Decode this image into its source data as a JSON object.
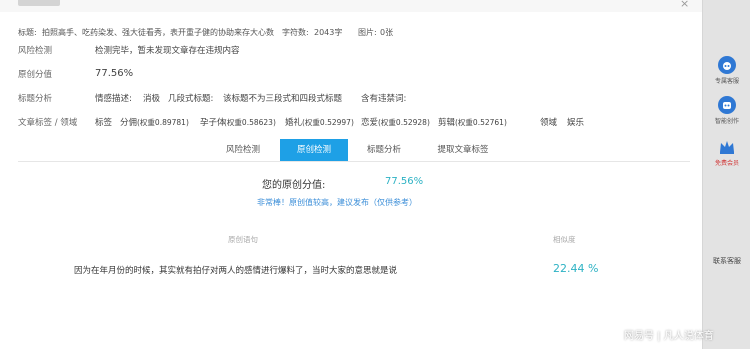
{
  "header": {
    "close_icon": "×"
  },
  "info": {
    "title_label": "标题:",
    "title": "拍照高手、吃药染发、强大徒看秀，表开重子健的协助来存大心数",
    "word_label": "字符数:",
    "word_count": "2043字",
    "image_label": "图片:",
    "image_count": "0张"
  },
  "risk": {
    "label": "风险检测",
    "value": "检测完毕，暂未发现文章存在违规内容"
  },
  "original": {
    "label": "原创分值",
    "value": "77.56%"
  },
  "title_analysis": {
    "label": "标题分析",
    "emotion_label": "情感描述:",
    "emotion_value": "消极",
    "style_label": "几段式标题:",
    "style_value": "该标题不为三段式和四段式标题",
    "forbidden_label": "含有违禁词:"
  },
  "tags": {
    "label": "文章标签 / 领域",
    "tag_label": "标签",
    "items": [
      {
        "name": "分佣",
        "weight": "(权重0.89781)"
      },
      {
        "name": "孕子体",
        "weight": "(权重0.58623)"
      },
      {
        "name": "婚礼",
        "weight": "(权重0.52997)"
      },
      {
        "name": "恋爱",
        "weight": "(权重0.52928)"
      },
      {
        "name": "剪辑",
        "weight": "(权重0.52761)"
      }
    ],
    "domain_label": "领域",
    "domain_value": "娱乐"
  },
  "tabs": [
    "风险检测",
    "原创检测",
    "标题分析",
    "提取文章标签"
  ],
  "score": {
    "label": "您的原创分值:",
    "value": "77.56%",
    "hint": "非常棒！原创值较高，建议发布（仅供参考）"
  },
  "table": {
    "col_sentence": "原创语句",
    "col_similarity": "相似度",
    "rows": [
      {
        "sentence": "因为在年月份的时候，其实就有拍仔对两人的感情进行爆料了，当时大家的意思就是说",
        "similarity": "22.44 %"
      }
    ]
  },
  "sidebar": {
    "items": [
      {
        "label": "专属客服",
        "icon": "headset-icon"
      },
      {
        "label": "智能创作",
        "icon": "robot-icon"
      },
      {
        "label": "免费会员",
        "icon": "crown-icon"
      }
    ],
    "contact": "联系客服"
  },
  "watermark": "网易号 | 凡人说体育",
  "colors": {
    "accent": "#1ea0e6",
    "teal": "#2db2c4",
    "link": "#3b8ed8"
  }
}
